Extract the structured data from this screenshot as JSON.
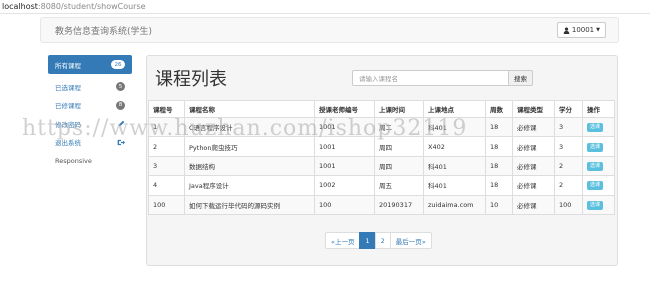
{
  "browser": {
    "host": "localhost",
    "path": ":8080/student/showCourse"
  },
  "navbar": {
    "brand": "教务信息查询系统(学生)",
    "user": "10001"
  },
  "sidebar": {
    "items": [
      {
        "label": "所有课程",
        "badge": "26"
      },
      {
        "label": "已选课程",
        "badge": "5"
      },
      {
        "label": "已修课程",
        "badge": "8"
      },
      {
        "label": "修改密码"
      },
      {
        "label": "退出系统"
      }
    ],
    "responsive": "Responsive"
  },
  "main": {
    "title": "课程列表",
    "search": {
      "placeholder": "请输入课程名",
      "button": "搜索"
    },
    "table": {
      "headers": [
        "课程号",
        "课程名称",
        "授课老师编号",
        "上课时间",
        "上课地点",
        "周数",
        "课程类型",
        "学分",
        "操作"
      ],
      "rows": [
        [
          "1",
          "C语言程序设计",
          "1001",
          "周二",
          "科401",
          "18",
          "必修课",
          "3",
          "选课"
        ],
        [
          "2",
          "Python爬虫技巧",
          "1001",
          "周四",
          "X402",
          "18",
          "必修课",
          "3",
          "选课"
        ],
        [
          "3",
          "数据结构",
          "1001",
          "周四",
          "科401",
          "18",
          "必修课",
          "2",
          "选课"
        ],
        [
          "4",
          "Java程序设计",
          "1002",
          "周五",
          "科401",
          "18",
          "必修课",
          "2",
          "选课"
        ],
        [
          "100",
          "如何下载运行毕代码的源码实例",
          "100",
          "20190317",
          "zuidaima.com",
          "10",
          "必修课",
          "100",
          "选课"
        ]
      ]
    },
    "pagination": [
      "«上一页",
      "1",
      "2",
      "最后一页»"
    ]
  },
  "watermark": "https://www.huzhan.com/ishop32119"
}
